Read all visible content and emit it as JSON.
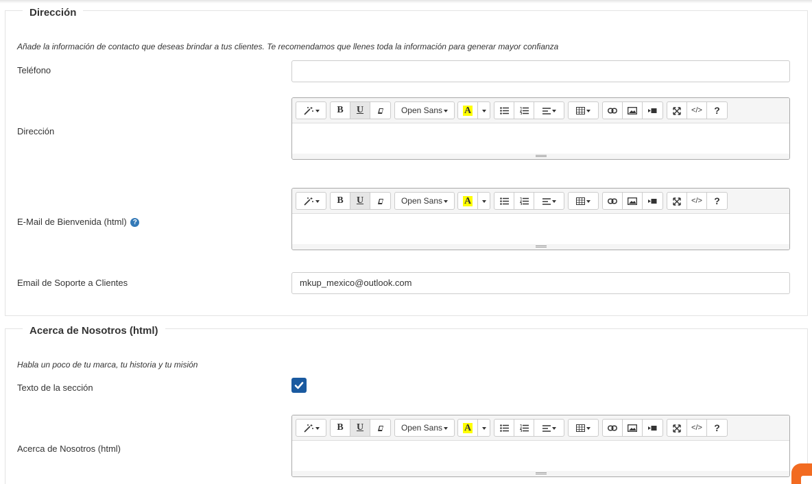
{
  "direccion_section": {
    "legend": "Dirección",
    "help": "Añade la información de contacto que deseas brindar a tus clientes. Te recomendamos que llenes toda la información para generar mayor confianza",
    "telefono_label": "Teléfono",
    "telefono_value": "",
    "direccion_label": "Dirección",
    "email_bienvenida_label": "E-Mail de Bienvenida (html)",
    "email_soporte_label": "Email de Soporte a Clientes",
    "email_soporte_value": "mkup_mexico@outlook.com"
  },
  "acerca_section": {
    "legend": "Acerca de Nosotros (html)",
    "help": "Habla un poco de tu marca, tu historia y tu misión",
    "texto_label": "Texto de la sección",
    "texto_checked": true,
    "acerca_label": "Acerca de Nosotros (html)"
  },
  "toolbar": {
    "font_name": "Open Sans",
    "color_letter": "A",
    "bold": "B",
    "underline": "U",
    "code": "</>",
    "help": "?"
  },
  "icons": {
    "help_badge": "question-circle-icon",
    "chat": "chat-icon"
  },
  "colors": {
    "checkbox": "#1a5aa0",
    "help_badge": "#3379b7",
    "highlight": "#ffff00",
    "chat_button": "#f26b21"
  }
}
